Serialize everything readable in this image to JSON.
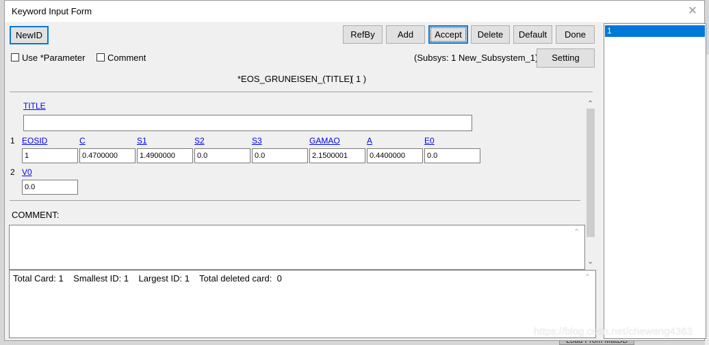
{
  "window": {
    "title": "Keyword Input Form"
  },
  "toolbar": {
    "newid": "NewID",
    "refby": "RefBy",
    "add": "Add",
    "accept": "Accept",
    "delete": "Delete",
    "default": "Default",
    "done": "Done",
    "setting": "Setting"
  },
  "options": {
    "use_parameter": "Use *Parameter",
    "comment": "Comment",
    "subsys": "(Subsys: 1 New_Subsystem_1)"
  },
  "keyword": {
    "heading": "*EOS_GRUNEISEN_(TITLE)",
    "count": "( 1 )"
  },
  "form": {
    "title_label": "TITLE",
    "title_value": "",
    "card1": {
      "index": "1",
      "fields": [
        {
          "label": "EOSID",
          "value": "1"
        },
        {
          "label": "C",
          "value": "0.4700000"
        },
        {
          "label": "S1",
          "value": "1.4900000"
        },
        {
          "label": "S2",
          "value": "0.0"
        },
        {
          "label": "S3",
          "value": "0.0"
        },
        {
          "label": "GAMAO",
          "value": "2.1500001"
        },
        {
          "label": "A",
          "value": "0.4400000"
        },
        {
          "label": "E0",
          "value": "0.0"
        }
      ]
    },
    "card2": {
      "index": "2",
      "fields": [
        {
          "label": "V0",
          "value": "0.0"
        }
      ]
    }
  },
  "comment_label": "COMMENT:",
  "status": "Total Card: 1    Smallest ID: 1    Largest ID: 1    Total deleted card:  0",
  "id_list": [
    "1"
  ],
  "background": {
    "watermark": "https://blog.csdn.net/cheweng4363",
    "load_button": "Load From MatDB"
  },
  "colors": {
    "accent": "#0078d7",
    "link": "#0000ee"
  }
}
